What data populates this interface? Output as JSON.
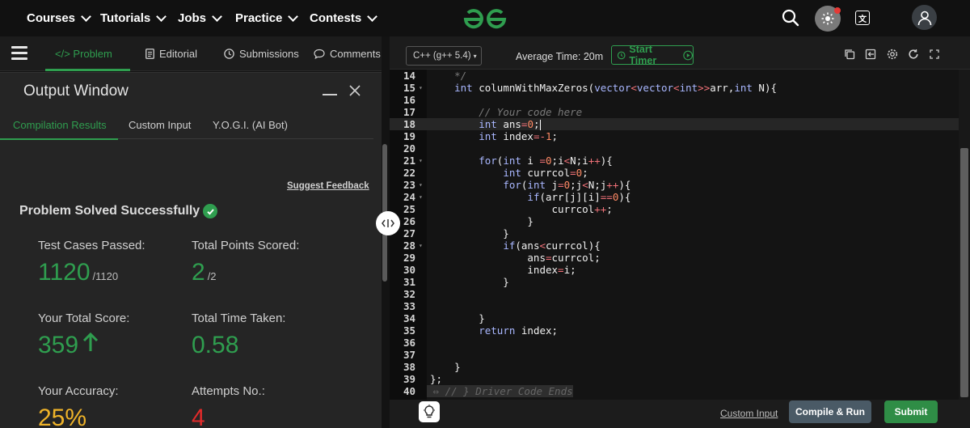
{
  "nav": {
    "items": [
      {
        "label": "Courses"
      },
      {
        "label": "Tutorials"
      },
      {
        "label": "Jobs"
      },
      {
        "label": "Practice"
      },
      {
        "label": "Contests"
      }
    ],
    "logo": "gfg-logo",
    "icons": [
      "search-icon",
      "theme-toggle-icon",
      "translate-icon",
      "user-icon"
    ]
  },
  "problem_tabs": {
    "problem": "</> Problem",
    "editorial": "Editorial",
    "submissions": "Submissions",
    "comments": "Comments"
  },
  "output": {
    "title": "Output Window",
    "subtabs": [
      "Compilation Results",
      "Custom Input",
      "Y.O.G.I. (AI Bot)"
    ],
    "suggest_feedback": "Suggest Feedback",
    "status": "Problem Solved Successfully",
    "test_cases_label": "Test Cases Passed:",
    "test_cases_value": "1120",
    "test_cases_total": "/1120",
    "points_label": "Total Points Scored:",
    "points_value": "2",
    "points_total": "/2",
    "score_label": "Your Total Score:",
    "score_value": "359",
    "time_label": "Total Time Taken:",
    "time_value": "0.58",
    "accuracy_label": "Your Accuracy:",
    "accuracy_value": "25%",
    "attempts_label": "Attempts No.:",
    "attempts_value": "4"
  },
  "editor_toolbar": {
    "language": "C++ (g++ 5.4)",
    "average_time": "Average Time: 20m",
    "start_timer": "Start Timer"
  },
  "code_lines": [
    {
      "n": "14",
      "text": "    */"
    },
    {
      "n": "15",
      "text": "    int columnWithMaxZeros(vector<vector<int>>arr,int N){"
    },
    {
      "n": "16",
      "text": ""
    },
    {
      "n": "17",
      "text": "        // Your code here"
    },
    {
      "n": "18",
      "text": "        int ans=0;"
    },
    {
      "n": "19",
      "text": "        int index=-1;"
    },
    {
      "n": "20",
      "text": ""
    },
    {
      "n": "21",
      "text": "        for(int i =0;i<N;i++){"
    },
    {
      "n": "22",
      "text": "            int currcol=0;"
    },
    {
      "n": "23",
      "text": "            for(int j=0;j<N;j++){"
    },
    {
      "n": "24",
      "text": "                if(arr[j][i]==0){"
    },
    {
      "n": "25",
      "text": "                    currcol++;"
    },
    {
      "n": "26",
      "text": "                }"
    },
    {
      "n": "27",
      "text": "            }"
    },
    {
      "n": "28",
      "text": "            if(ans<currcol){"
    },
    {
      "n": "29",
      "text": "                ans=currcol;"
    },
    {
      "n": "30",
      "text": "                index=i;"
    },
    {
      "n": "31",
      "text": "            }"
    },
    {
      "n": "32",
      "text": ""
    },
    {
      "n": "33",
      "text": ""
    },
    {
      "n": "34",
      "text": "        }"
    },
    {
      "n": "35",
      "text": "        return index;"
    },
    {
      "n": "36",
      "text": ""
    },
    {
      "n": "37",
      "text": ""
    },
    {
      "n": "38",
      "text": "    }"
    },
    {
      "n": "39",
      "text": "};"
    },
    {
      "n": "40",
      "text": "// } Driver Code Ends"
    }
  ],
  "bottom": {
    "custom_input": "Custom Input",
    "compile_run": "Compile & Run",
    "submit": "Submit"
  }
}
